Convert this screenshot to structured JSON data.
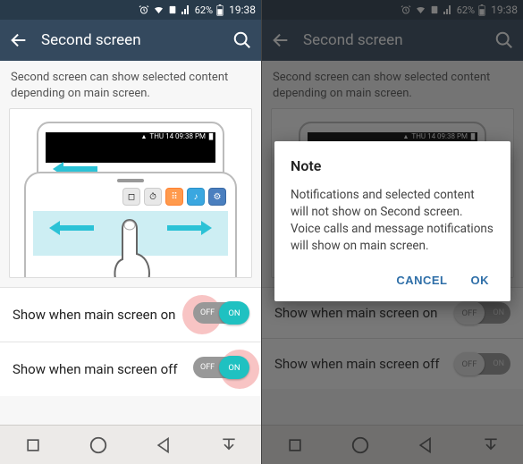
{
  "status": {
    "battery": "62%",
    "time": "19:38"
  },
  "header": {
    "title": "Second screen"
  },
  "description": "Second screen can show selected content depending on main screen.",
  "illustration": {
    "back_status": "THU 14   09:38 PM"
  },
  "rows": {
    "row1": {
      "label": "Show when main screen on",
      "state_on": "ON",
      "state_off": "OFF"
    },
    "row2": {
      "label": "Show when main screen off",
      "state_on": "ON",
      "state_off": "OFF"
    }
  },
  "dialog": {
    "title": "Note",
    "body": "Notifications and selected content will not show on Second screen. Voice calls and message notifications will show on main screen.",
    "cancel": "CANCEL",
    "ok": "OK"
  }
}
